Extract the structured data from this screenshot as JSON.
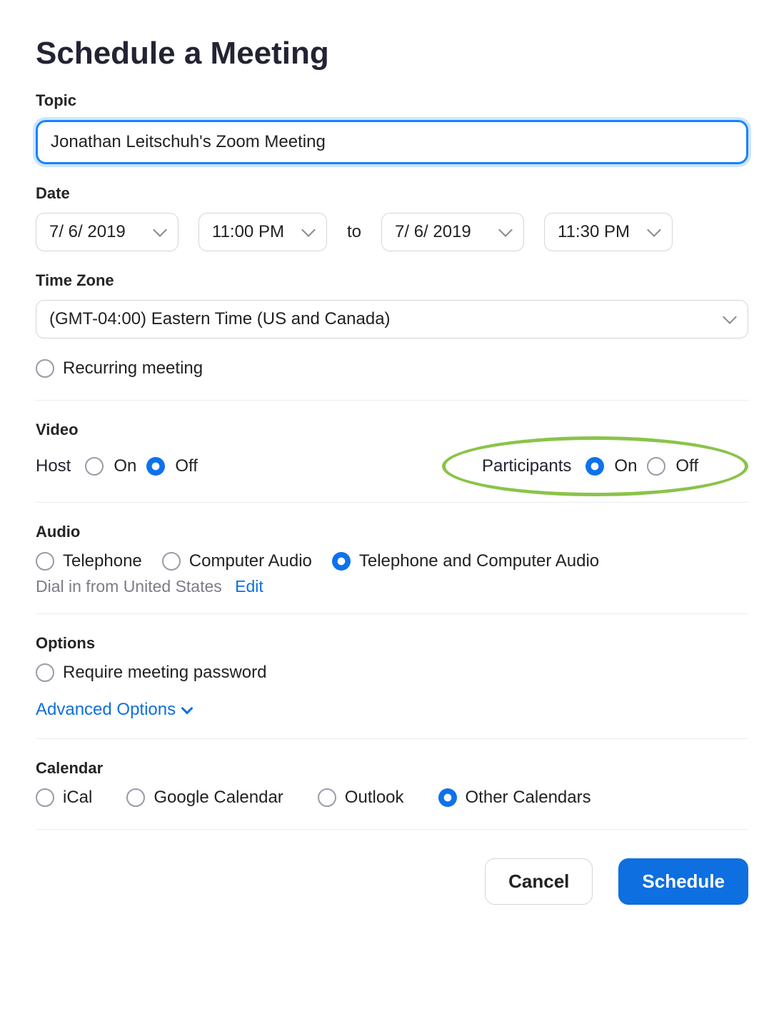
{
  "title": "Schedule a Meeting",
  "topic": {
    "label": "Topic",
    "value": "Jonathan Leitschuh's Zoom Meeting"
  },
  "date": {
    "label": "Date",
    "start_date": "7/ 6/ 2019",
    "start_time": "11:00 PM",
    "to": "to",
    "end_date": "7/ 6/ 2019",
    "end_time": "11:30 PM"
  },
  "timezone": {
    "label": "Time Zone",
    "value": "(GMT-04:00) Eastern Time (US and Canada)"
  },
  "recurring": {
    "label": "Recurring meeting",
    "checked": false
  },
  "video": {
    "label": "Video",
    "host_label": "Host",
    "host_on": "On",
    "host_off": "Off",
    "host_value": "off",
    "participants_label": "Participants",
    "participants_on": "On",
    "participants_off": "Off",
    "participants_value": "on"
  },
  "audio": {
    "label": "Audio",
    "options": {
      "telephone": "Telephone",
      "computer": "Computer Audio",
      "both": "Telephone and Computer Audio"
    },
    "selected": "both",
    "dial_text": "Dial in from United States",
    "edit": "Edit"
  },
  "options": {
    "label": "Options",
    "require_password": "Require meeting password",
    "require_password_checked": false,
    "advanced": "Advanced Options"
  },
  "calendar": {
    "label": "Calendar",
    "items": {
      "ical": "iCal",
      "google": "Google Calendar",
      "outlook": "Outlook",
      "other": "Other Calendars"
    },
    "selected": "other"
  },
  "footer": {
    "cancel": "Cancel",
    "schedule": "Schedule"
  }
}
